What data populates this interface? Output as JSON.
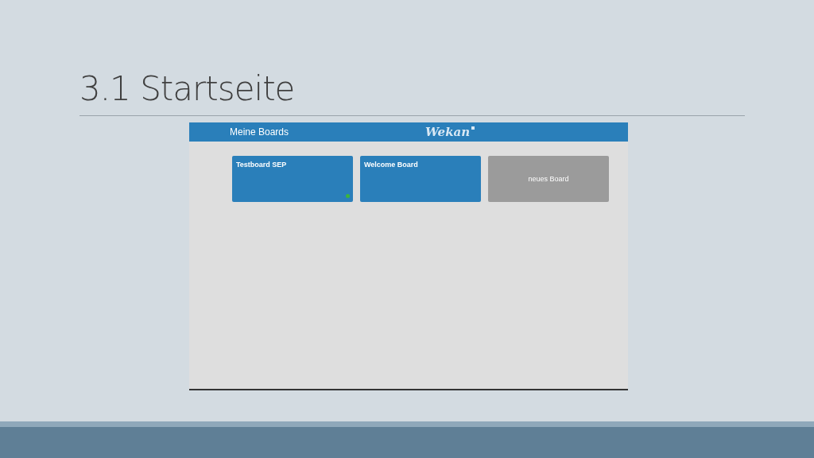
{
  "slide_title": "3.1 Startseite",
  "app": {
    "header_title": "Meine Boards",
    "logo": "Wekan",
    "boards": [
      {
        "kind": "board",
        "title": "Testboard SEP",
        "status_dot": true
      },
      {
        "kind": "board",
        "title": "Welcome Board",
        "status_dot": false
      },
      {
        "kind": "add",
        "title": "neues Board",
        "status_dot": false
      }
    ]
  }
}
